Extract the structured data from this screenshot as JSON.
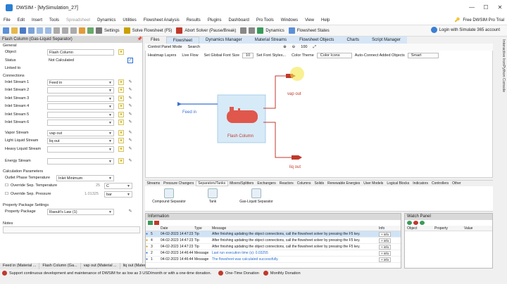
{
  "window": {
    "title": "DWSIM - [MySimulation_27]",
    "controls": [
      "—",
      "☐",
      "✕"
    ]
  },
  "menu": {
    "items": [
      "File",
      "Edit",
      "Insert",
      "Tools",
      "Spreadsheet",
      "Dynamics",
      "Utilities",
      "Flowsheet Analysis",
      "Results",
      "Plugins",
      "Dashboard",
      "Pro Tools",
      "Windows",
      "View",
      "Help"
    ],
    "pro_trial": "Free DWSIM Pro Trial",
    "login": "Login with Simulate 365 account"
  },
  "toolbar": {
    "settings": "Settings",
    "solve": "Solve Flowsheet (F5)",
    "abort": "Abort Solver (Pause/Break)",
    "dynamics": "Dynamics",
    "flowsheet_states": "Flowsheet States"
  },
  "left_panel": {
    "header": "Flash Column (Gas-Liquid Separator)",
    "general_label": "General",
    "object_label": "Object",
    "object_value": "Flash Column",
    "status_label": "Status",
    "status_value": "Not Calculated",
    "linked_label": "Linked to",
    "connections_label": "Connections",
    "inlet1_label": "Inlet Stream 1",
    "inlet1_value": "Feed in",
    "inlet2_label": "Inlet Stream 2",
    "inlet3_label": "Inlet Stream 3",
    "inlet4_label": "Inlet Stream 4",
    "inlet5_label": "Inlet Stream 5",
    "inlet6_label": "Inlet Stream 6",
    "vapor_label": "Vapor Stream",
    "vapor_value": "vap out",
    "light_label": "Light Liquid Stream",
    "light_value": "liq out",
    "heavy_label": "Heavy Liquid Stream",
    "energy_label": "Energy Stream",
    "calc_params_label": "Calculation Parameters",
    "outlet_temp_label": "Outlet Phase Temperature",
    "outlet_temp_value": "Inlet Minimum",
    "override_temp_label": "Override Sep. Temperature",
    "override_temp_value": "25",
    "override_temp_unit": "C",
    "override_press_label": "Override Sep. Pressure",
    "override_press_value": "1.01325",
    "override_press_unit": "bar",
    "property_pkg_section": "Property Package Settings",
    "property_pkg_label": "Property Package",
    "property_pkg_value": "Raoult's Law (1)",
    "notes_label": "Notes"
  },
  "doc_tabs": [
    "Feed in (Material ...",
    "Flash Column (Ga...",
    "vap out (Material ...",
    "liq out (Material ..."
  ],
  "status_line": {
    "message": "Support continuous development and maintenance of DWSIM for as low as 3 USD/month or with a one-time donation.",
    "donation": "One-Time Donation",
    "monthly": "Monthly Donation"
  },
  "main_tabs": [
    "Files",
    "Flowsheet",
    "Dynamics Manager",
    "Material Streams",
    "Flowsheet Objects",
    "Charts",
    "Script Manager"
  ],
  "canvas_bar": {
    "control_panel": "Control Panel Mode",
    "search": "Search",
    "zoom": "100"
  },
  "canvas_bar2": {
    "heatmap": "Heatmap Layers",
    "live_flow": "Live Flow",
    "font_size_label": "Set Global Font Size",
    "font_size_value": "10",
    "font_styles": "Set Font Styles...",
    "color_theme": "Color Theme",
    "color_icons": "Color Icons",
    "auto_connect": "Auto-Connect Added Objects",
    "smart": "Smart"
  },
  "flowsheet": {
    "feed_label": "Feed in",
    "flash_label": "Flash Column",
    "vap_label": "vap out",
    "liq_label": "liq out"
  },
  "palette_tabs": [
    "Streams",
    "Pressure Changers",
    "Separators/Tanks",
    "Mixers/Splitters",
    "Exchangers",
    "Reactors",
    "Columns",
    "Solids",
    "Renewable Energies",
    "User Models",
    "Logical Blocks",
    "Indicators",
    "Controllers",
    "Other"
  ],
  "palette_items": [
    "Compound Separator",
    "Tank",
    "Gas-Liquid Separator"
  ],
  "info_panel": {
    "header": "Information",
    "columns": [
      "Date",
      "Type",
      "Message",
      "Info"
    ],
    "rows": [
      {
        "num": "5",
        "date": "04-02-2023 14:47:23",
        "type": "Tip",
        "msg": "After finishing updating the object connections, call the flowsheet solver by pressing the F5 key.",
        "info": "+ info"
      },
      {
        "num": "4",
        "date": "04-02-2023 14:47:23",
        "type": "Tip",
        "msg": "After finishing updating the object connections, call the flowsheet solver by pressing the F5 key.",
        "info": "+ info"
      },
      {
        "num": "3",
        "date": "04-02-2023 14:47:23",
        "type": "Tip",
        "msg": "After finishing updating the object connections, call the flowsheet solver by pressing the F5 key.",
        "info": "+ info"
      },
      {
        "num": "2",
        "date": "04-02-2023 14:46:44",
        "type": "Message",
        "msg": "Last run execution time (s): 0.03255",
        "info": "+ info"
      },
      {
        "num": "1",
        "date": "04-02-2023 14:46:44",
        "type": "Message",
        "msg": "The flowsheet was calculated successfully.",
        "info": "+ info"
      }
    ]
  },
  "watch_panel": {
    "header": "Watch Panel",
    "columns": [
      "Object",
      "Property",
      "Value"
    ]
  },
  "side_vertical": "Interactive IronPython Console",
  "colors": {
    "accent_blue": "#2a6fcf",
    "stream_blue": "#3b6fd4",
    "stream_red": "#c0392b",
    "vessel": "#e0574c",
    "vessel_box": "#d7eaf7"
  }
}
